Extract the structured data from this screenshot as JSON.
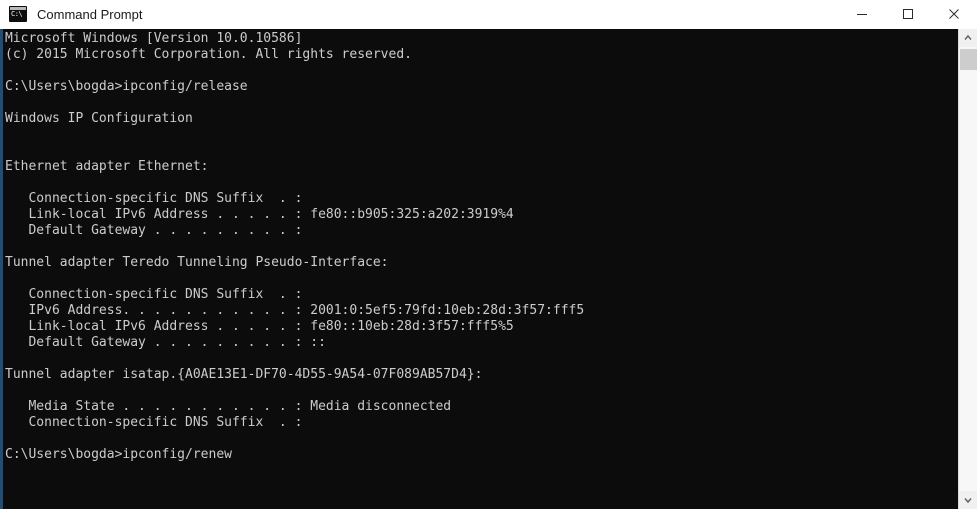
{
  "window": {
    "title": "Command Prompt",
    "icon": "console-icon",
    "icon_glyph": "C:\\",
    "controls": [
      {
        "name": "minimize-button",
        "label": "Minimize"
      },
      {
        "name": "maximize-button",
        "label": "Maximize"
      },
      {
        "name": "close-button",
        "label": "Close"
      }
    ]
  },
  "colors": {
    "titlebar_background": "#ffffff",
    "titlebar_text": "#1b1b1b",
    "console_background": "#0c0c0c",
    "console_text": "#cccccc",
    "window_accent_border": "#1f4e79",
    "scrollbar_track": "#f7f7f7",
    "scrollbar_thumb": "#cdcdcd"
  },
  "console": {
    "prompt_user_path": "C:\\Users\\bogda",
    "lines": [
      "Microsoft Windows [Version 10.0.10586]",
      "(c) 2015 Microsoft Corporation. All rights reserved.",
      "",
      "C:\\Users\\bogda>ipconfig/release",
      "",
      "Windows IP Configuration",
      "",
      "",
      "Ethernet adapter Ethernet:",
      "",
      "   Connection-specific DNS Suffix  . :",
      "   Link-local IPv6 Address . . . . . : fe80::b905:325:a202:3919%4",
      "   Default Gateway . . . . . . . . . :",
      "",
      "Tunnel adapter Teredo Tunneling Pseudo-Interface:",
      "",
      "   Connection-specific DNS Suffix  . :",
      "   IPv6 Address. . . . . . . . . . . : 2001:0:5ef5:79fd:10eb:28d:3f57:fff5",
      "   Link-local IPv6 Address . . . . . : fe80::10eb:28d:3f57:fff5%5",
      "   Default Gateway . . . . . . . . . : ::",
      "",
      "Tunnel adapter isatap.{A0AE13E1-DF70-4D55-9A54-07F089AB57D4}:",
      "",
      "   Media State . . . . . . . . . . . : Media disconnected",
      "   Connection-specific DNS Suffix  . :",
      "",
      "C:\\Users\\bogda>ipconfig/renew",
      "",
      ""
    ],
    "commands": [
      "ipconfig/release",
      "ipconfig/renew"
    ],
    "adapters": [
      {
        "name": "Ethernet adapter Ethernet",
        "connection_specific_dns_suffix": "",
        "link_local_ipv6_address": "fe80::b905:325:a202:3919%4",
        "default_gateway": ""
      },
      {
        "name": "Tunnel adapter Teredo Tunneling Pseudo-Interface",
        "connection_specific_dns_suffix": "",
        "ipv6_address": "2001:0:5ef5:79fd:10eb:28d:3f57:fff5",
        "link_local_ipv6_address": "fe80::10eb:28d:3f57:fff5%5",
        "default_gateway": "::"
      },
      {
        "name": "Tunnel adapter isatap.{A0AE13E1-DF70-4D55-9A54-07F089AB57D4}",
        "media_state": "Media disconnected",
        "connection_specific_dns_suffix": ""
      }
    ],
    "os_banner": "Microsoft Windows [Version 10.0.10586]",
    "copyright": "(c) 2015 Microsoft Corporation. All rights reserved.",
    "section_heading": "Windows IP Configuration"
  },
  "scrollbar": {
    "up_arrow": "chevron-up-icon",
    "down_arrow": "chevron-down-icon"
  }
}
